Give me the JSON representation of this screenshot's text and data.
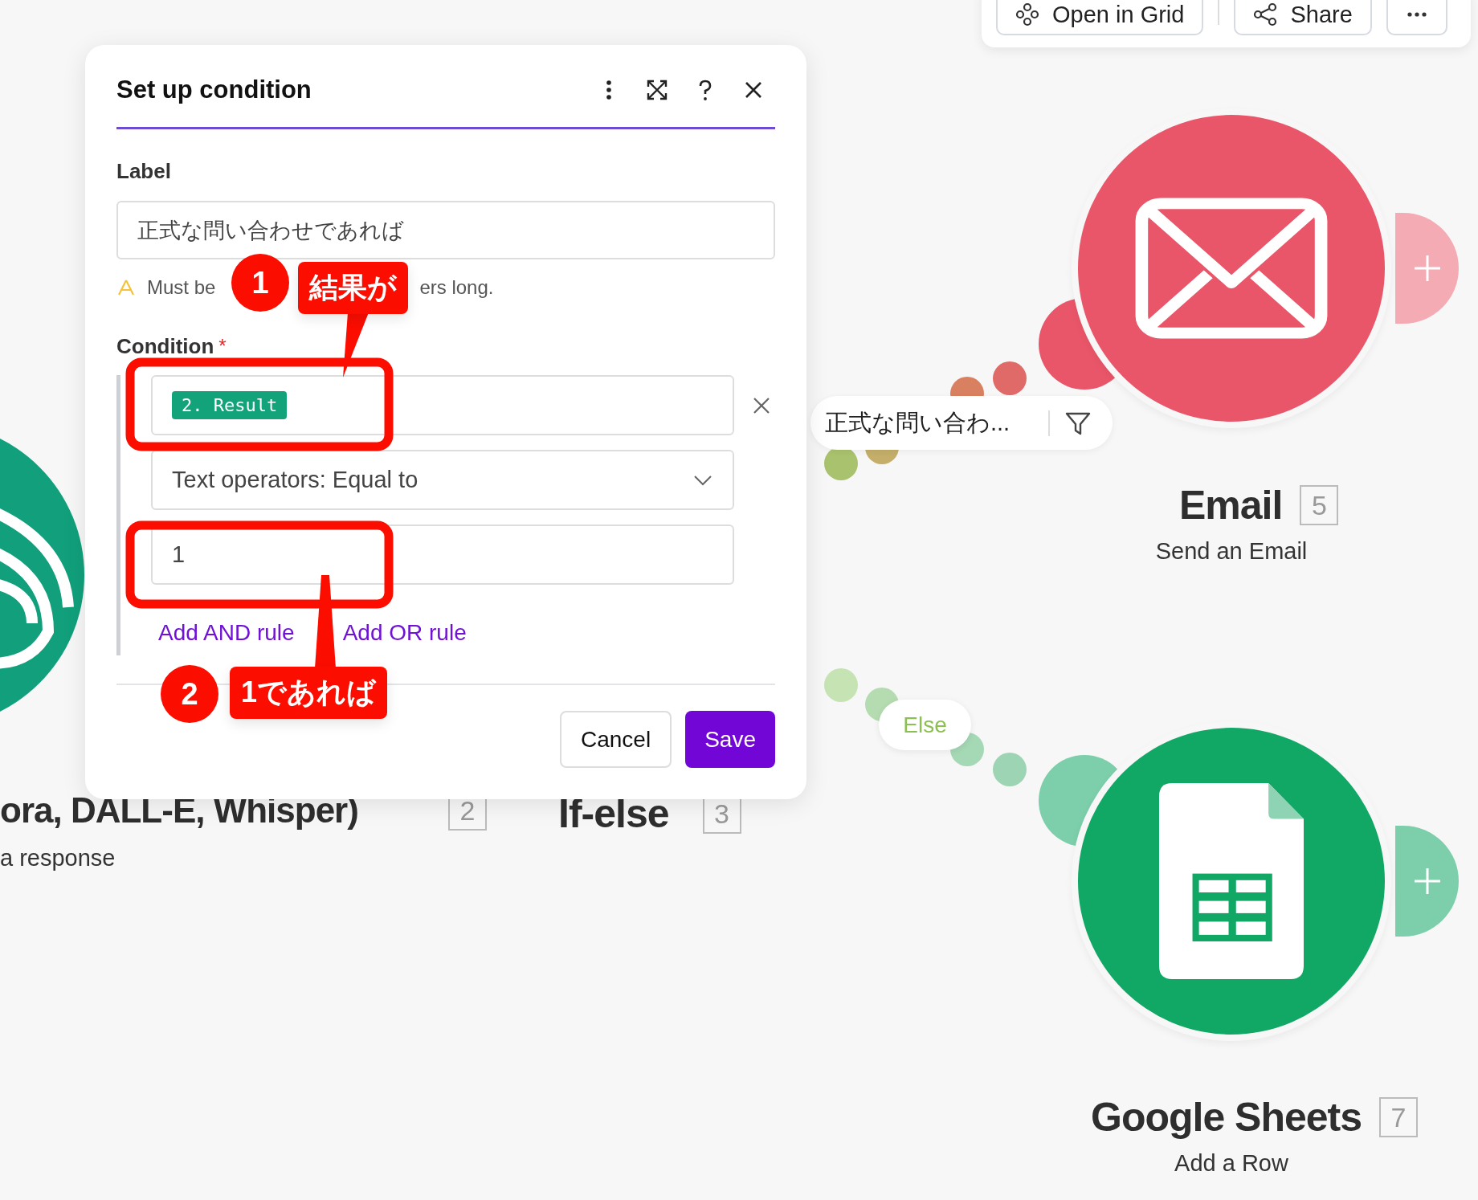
{
  "toolbar": {
    "buttons": [
      {
        "kind": "grid",
        "label": "Open in Grid"
      },
      {
        "kind": "share",
        "label": "Share"
      },
      {
        "kind": "more"
      }
    ]
  },
  "nodes": [
    {
      "kind": "email",
      "title": "Email",
      "number": "5",
      "subtitle": "Send an Email",
      "color": "#ea5669"
    },
    {
      "kind": "sheets",
      "title": "Google Sheets",
      "number": "7",
      "subtitle": "Add a Row",
      "color": "#11a764"
    },
    {
      "kind": "app",
      "title": "ora, DALL-E, Whisper)",
      "number": "2",
      "subtitle": "a response",
      "color": "#11a07b"
    },
    {
      "kind": "router",
      "title": "If-else",
      "number": "3"
    }
  ],
  "routes": [
    {
      "kind": "filter",
      "label": "正式な問い合わ..."
    },
    {
      "kind": "else",
      "label": "Else"
    }
  ],
  "dialog": {
    "title": "Set up condition",
    "label_field": {
      "label": "Label",
      "value": "正式な問い合わせであれば"
    },
    "warning": [
      "Must be",
      "ers long."
    ],
    "condition": {
      "label": "Condition",
      "required_mark": "*",
      "rules": [
        {
          "tag": "2. Result",
          "operator": "Text operators: Equal to",
          "value": "1"
        }
      ],
      "links": [
        "Add AND rule",
        "Add OR rule"
      ]
    },
    "buttons": [
      {
        "kind": "secondary",
        "label": "Cancel"
      },
      {
        "kind": "primary",
        "label": "Save"
      }
    ]
  },
  "annotations": [
    {
      "number": "1",
      "text": "結果が"
    },
    {
      "number": "2",
      "text": "1であれば"
    }
  ]
}
